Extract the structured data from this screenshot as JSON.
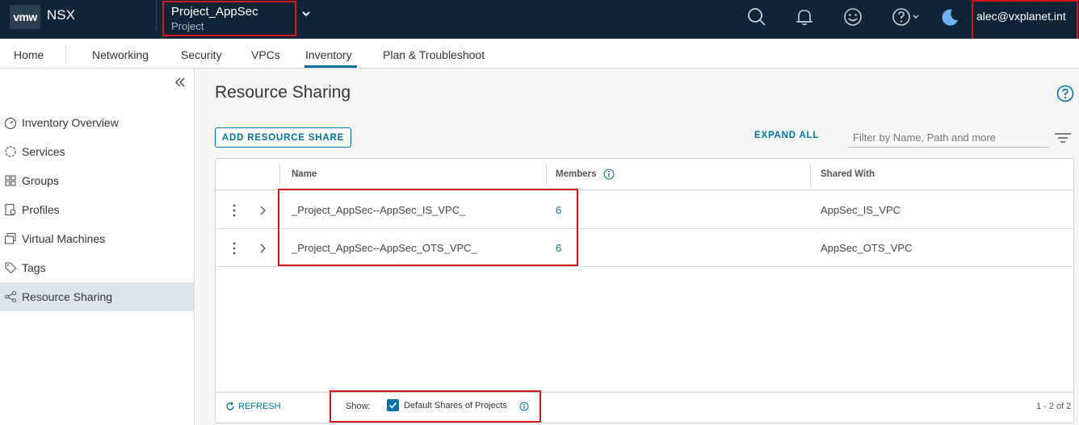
{
  "header": {
    "logo": "vmw",
    "product": "NSX",
    "project_name": "Project_AppSec",
    "project_type": "Project",
    "user": "alec@vxplanet.int",
    "icons": [
      "search-icon",
      "bell-icon",
      "smiley-icon",
      "help-icon",
      "moon-icon"
    ]
  },
  "nav": {
    "tabs": [
      {
        "label": "Home"
      },
      {
        "label": "Networking"
      },
      {
        "label": "Security"
      },
      {
        "label": "VPCs"
      },
      {
        "label": "Inventory",
        "active": true
      },
      {
        "label": "Plan & Troubleshoot"
      }
    ]
  },
  "sidebar": {
    "items": [
      {
        "label": "Inventory Overview",
        "icon": "gauge-icon"
      },
      {
        "label": "Services",
        "icon": "services-icon"
      },
      {
        "label": "Groups",
        "icon": "groups-icon"
      },
      {
        "label": "Profiles",
        "icon": "profiles-icon"
      },
      {
        "label": "Virtual Machines",
        "icon": "vm-icon"
      },
      {
        "label": "Tags",
        "icon": "tag-icon"
      },
      {
        "label": "Resource Sharing",
        "icon": "share-icon",
        "active": true
      }
    ]
  },
  "main": {
    "title": "Resource Sharing",
    "add_button": "ADD RESOURCE SHARE",
    "expand_all": "EXPAND ALL",
    "filter_placeholder": "Filter by Name, Path and more",
    "columns": {
      "name": "Name",
      "members": "Members",
      "shared_with": "Shared With"
    },
    "rows": [
      {
        "name": "_Project_AppSec--AppSec_IS_VPC_",
        "members": "6",
        "shared_with": "AppSec_IS_VPC"
      },
      {
        "name": "_Project_AppSec--AppSec_OTS_VPC_",
        "members": "6",
        "shared_with": "AppSec_OTS_VPC"
      }
    ],
    "footer": {
      "refresh": "REFRESH",
      "show_label": "Show:",
      "checkbox_label": "Default Shares of Projects",
      "checkbox_checked": true,
      "pagination": "1 - 2 of 2"
    }
  },
  "colors": {
    "header_bg": "#0f2436",
    "accent": "#0072a3",
    "highlight": "#d0161b",
    "sidebar_active": "#dde4ec"
  }
}
